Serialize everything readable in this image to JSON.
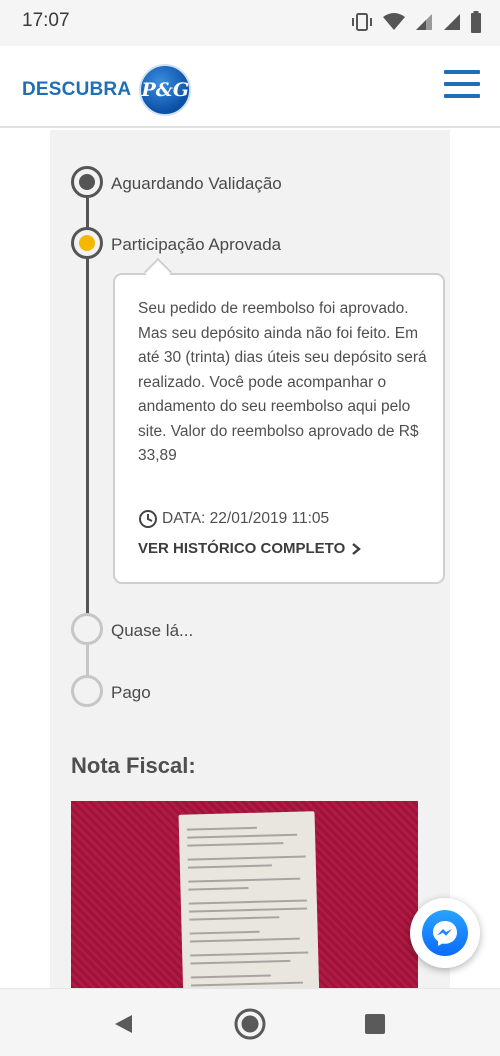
{
  "status_bar": {
    "time": "17:07",
    "icons": [
      "vibrate-icon",
      "wifi-icon",
      "signal-icon",
      "signal-icon",
      "battery-icon"
    ]
  },
  "header": {
    "brand_text": "DESCUBRA",
    "logo_text": "P&G",
    "menu_icon": "hamburger-menu-icon"
  },
  "timeline": {
    "steps": [
      {
        "label": "Aguardando Validação",
        "state": "done"
      },
      {
        "label": "Participação Aprovada",
        "state": "active"
      },
      {
        "label": "Quase lá...",
        "state": "pending"
      },
      {
        "label": "Pago",
        "state": "pending"
      }
    ]
  },
  "details_card": {
    "message": "Seu pedido de reembolso foi aprovado. Mas seu depósito ainda não foi feito. Em até 30 (trinta) dias úteis seu depósito será realizado. Você pode acompanhar o andamento do seu reembolso aqui pelo site. Valor do reembolso aprovado de R$ 33,89",
    "date": "DATA: 22/01/2019 11:05",
    "history_link": "VER HISTÓRICO COMPLETO"
  },
  "invoice": {
    "title": "Nota Fiscal:",
    "image": "receipt-photo"
  },
  "messenger_button": {
    "icon": "messenger-icon"
  },
  "nav_bar": {
    "icons": [
      "back-icon",
      "home-icon",
      "recents-icon"
    ]
  },
  "colors": {
    "brand_blue": "#1f6fb6",
    "active_step": "#f5b800",
    "panel_bg": "#f2f2f2",
    "receipt_bg": "#a6163d"
  }
}
